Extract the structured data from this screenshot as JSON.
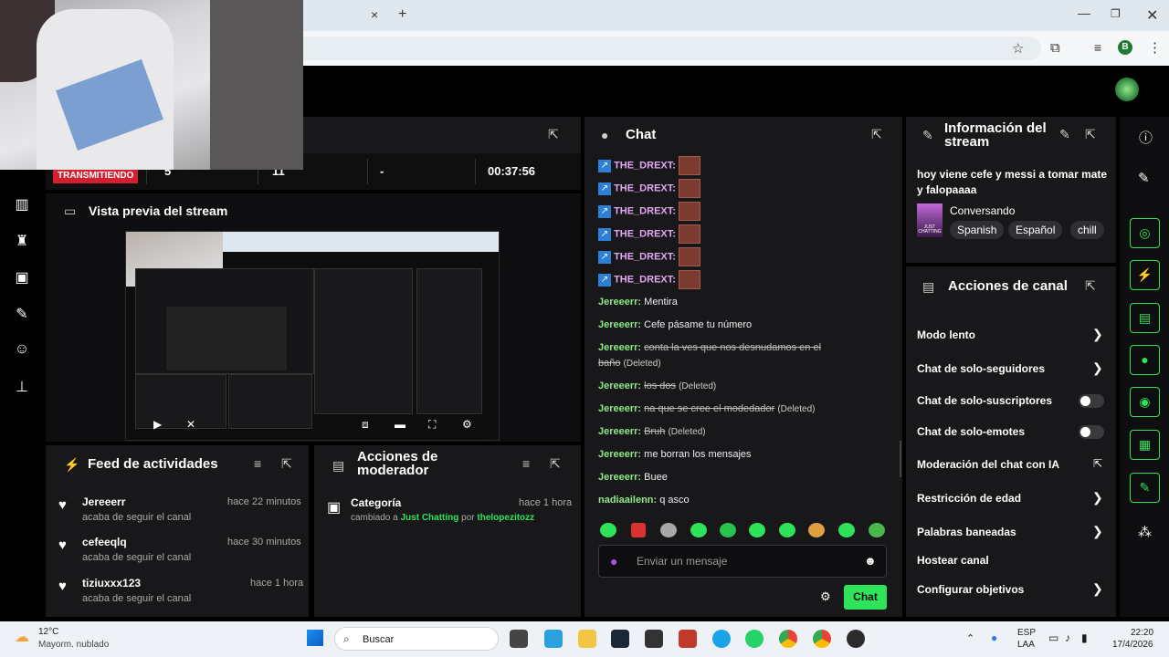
{
  "browser": {
    "tab_close": "×",
    "new_tab": "+",
    "profile_initial": "B"
  },
  "stats": {
    "live_label": "TRANSMITIENDO",
    "viewers": "5",
    "followers": "11",
    "subs": "-",
    "uptime": "00:37:56"
  },
  "preview": {
    "title": "Vista previa del stream"
  },
  "activity": {
    "title": "Feed de actividades",
    "items": [
      {
        "user": "Jereeerr",
        "action": "acaba de seguir el canal",
        "time": "hace 22 minutos"
      },
      {
        "user": "cefeeqlq",
        "action": "acaba de seguir el canal",
        "time": "hace 30 minutos"
      },
      {
        "user": "tiziuxxx123",
        "action": "acaba de seguir el canal",
        "time": "hace 1 hora"
      }
    ]
  },
  "mod_actions": {
    "title": "Acciones de moderador",
    "item_title": "Categoría",
    "item_prefix": "cambiado a",
    "item_category": "Just Chatting",
    "item_by": "por",
    "item_user": "thelopezitozz",
    "item_time": "hace 1 hora"
  },
  "chat": {
    "title": "Chat",
    "drext_user": "THE_DREXT:",
    "messages": [
      {
        "user": "Jereeerr:",
        "text": "Mentira",
        "deleted": false
      },
      {
        "user": "Jereeerr:",
        "text": "Cefe pásame tu número",
        "deleted": false
      },
      {
        "user": "Jereeerr:",
        "text": "conta la ves que nos desnudamos en el",
        "text2": "baño",
        "deleted": true
      },
      {
        "user": "Jereeerr:",
        "text": "los dos",
        "deleted": true
      },
      {
        "user": "Jereeerr:",
        "text": "na que se cree el modedador",
        "deleted": true
      },
      {
        "user": "Jereeerr:",
        "text": "Bruh",
        "deleted": true
      },
      {
        "user": "Jereeerr:",
        "text": "me borran los mensajes",
        "deleted": false
      },
      {
        "user": "Jereeerr:",
        "text": "Buee",
        "deleted": false
      },
      {
        "user": "nadiaailenn:",
        "text": "q asco",
        "deleted": false
      }
    ],
    "deleted_tag": "(Deleted)",
    "placeholder": "Enviar un mensaje",
    "send_label": "Chat"
  },
  "stream_info": {
    "title_line1": "Información del",
    "title_line2": "stream",
    "stream_title": "hoy viene cefe y messi a tomar mate y falopaaaa",
    "category": "Conversando",
    "category_art": "JUST CHATTING",
    "tags": [
      "Spanish",
      "Español",
      "chill"
    ]
  },
  "channel_actions": {
    "title": "Acciones de canal",
    "rows": [
      {
        "label": "Modo lento",
        "control": "chevron"
      },
      {
        "label": "Chat de solo-seguidores",
        "control": "chevron"
      },
      {
        "label": "Chat de solo-suscriptores",
        "control": "toggle"
      },
      {
        "label": "Chat de solo-emotes",
        "control": "toggle"
      },
      {
        "label": "Moderación del chat con IA",
        "control": "external"
      },
      {
        "label": "Restricción de edad",
        "control": "chevron"
      },
      {
        "label": "Palabras baneadas",
        "control": "chevron"
      },
      {
        "label": "Hostear canal",
        "control": "none"
      },
      {
        "label": "Configurar objetivos",
        "control": "chevron"
      }
    ]
  },
  "taskbar": {
    "temp": "12°C",
    "weather": "Mayorm. nublado",
    "search": "Buscar",
    "lang1": "ESP",
    "lang2": "LAA",
    "time": "22:20",
    "date": "17/4/2026"
  },
  "colors": {
    "accent": "#2ee35a",
    "live": "#d41f2f",
    "panel": "#18181b"
  }
}
